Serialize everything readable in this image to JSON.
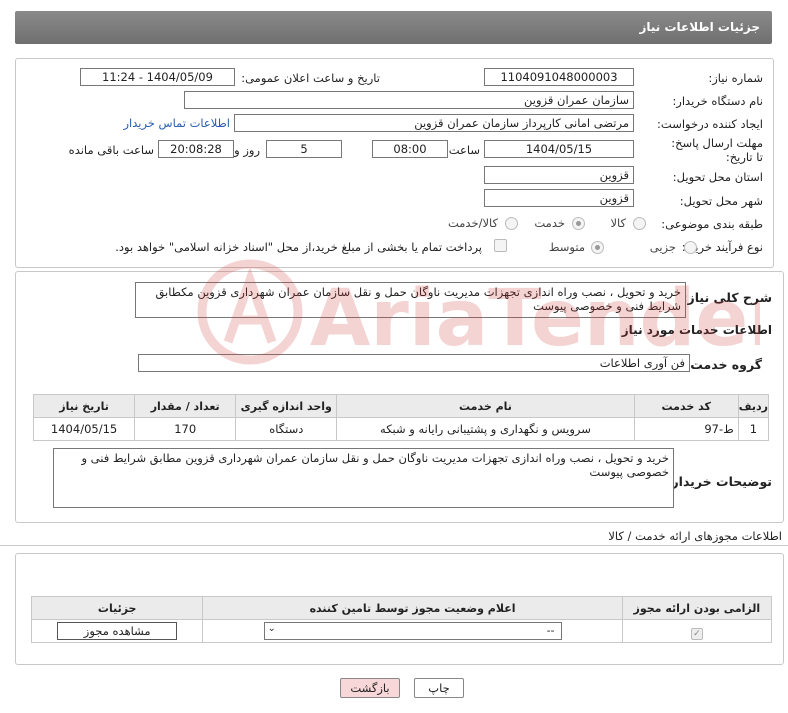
{
  "page_title": "جزئیات اطلاعات نیاز",
  "fields": {
    "need_number_label": "شماره نیاز:",
    "need_number": "1104091048000003",
    "announce_label": "تاریخ و ساعت اعلان عمومی:",
    "announce_value": "1404/05/09 - 11:24",
    "buyer_org_label": "نام دستگاه خریدار:",
    "buyer_org": "سازمان عمران قزوین",
    "creator_label": "ایجاد کننده درخواست:",
    "creator": "مرتضی امانی کارپرداز سازمان عمران قزوین",
    "contact_link": "اطلاعات تماس خریدار",
    "deadline_label": "مهلت ارسال پاسخ: تا تاریخ:",
    "deadline_date": "1404/05/15",
    "hour_label": "ساعت",
    "deadline_hour": "08:00",
    "days": "5",
    "days_label": "روز و",
    "remaining": "20:08:28",
    "remaining_label": "ساعت باقی مانده",
    "province_label": "استان محل تحویل:",
    "province": "قزوین",
    "city_label": "شهر محل تحویل:",
    "city": "قزوین",
    "category_label": "طبقه بندی موضوعی:",
    "category_options": [
      "کالا",
      "خدمت",
      "کالا/خدمت"
    ],
    "category_selected": "خدمت",
    "process_label": "نوع فرآیند خرید :",
    "process_options": [
      "جزیی",
      "متوسط"
    ],
    "process_selected": "متوسط",
    "treasury_note": "پرداخت تمام یا بخشی از مبلغ خرید،از محل \"اسناد خزانه اسلامی\" خواهد بود."
  },
  "summary": {
    "label": "شرح کلی نیاز:",
    "text": "خرید و تحویل ، نصب وراه اندازی  تجهزات مدیریت ناوگان حمل و نقل سازمان عمران شهرداری قزوین مکطابق شرایط فنی و خصوصی پیوست"
  },
  "services": {
    "heading": "اطلاعات خدمات مورد نیاز",
    "group_label": "گروه خدمت:",
    "group_value": "فن آوری اطلاعات",
    "columns": [
      "ردیف",
      "کد خدمت",
      "نام خدمت",
      "واحد اندازه گیری",
      "تعداد / مقدار",
      "تاریخ نیاز"
    ],
    "rows": [
      [
        "1",
        "ط-97",
        "سرویس و نگهداری و پشتیبانی رایانه و شبکه",
        "دستگاه",
        "170",
        "1404/05/15"
      ]
    ]
  },
  "buyer_notes": {
    "label": "توضیحات خریدار:",
    "text": "خرید و تحویل ، نصب وراه اندازی  تجهزات مدیریت ناوگان حمل و نقل سازمان عمران شهرداری قزوین مطابق شرایط فنی و خصوصی پیوست"
  },
  "permits": {
    "heading": "اطلاعات مجوزهای ارائه خدمت / کالا",
    "columns": [
      "الزامی بودن ارائه مجوز",
      "اعلام وضعیت مجوز توسط تامین کننده",
      "جزئیات"
    ],
    "select_value": "--",
    "view_button": "مشاهده مجوز"
  },
  "buttons": {
    "print": "چاپ",
    "back": "بازگشت"
  },
  "watermark": "AriaTender.neT",
  "colors": {
    "link": "#2a5db0",
    "back_button": "#f7d7d7",
    "header": "#7a7a7a",
    "watermark": "#d23a3a"
  }
}
